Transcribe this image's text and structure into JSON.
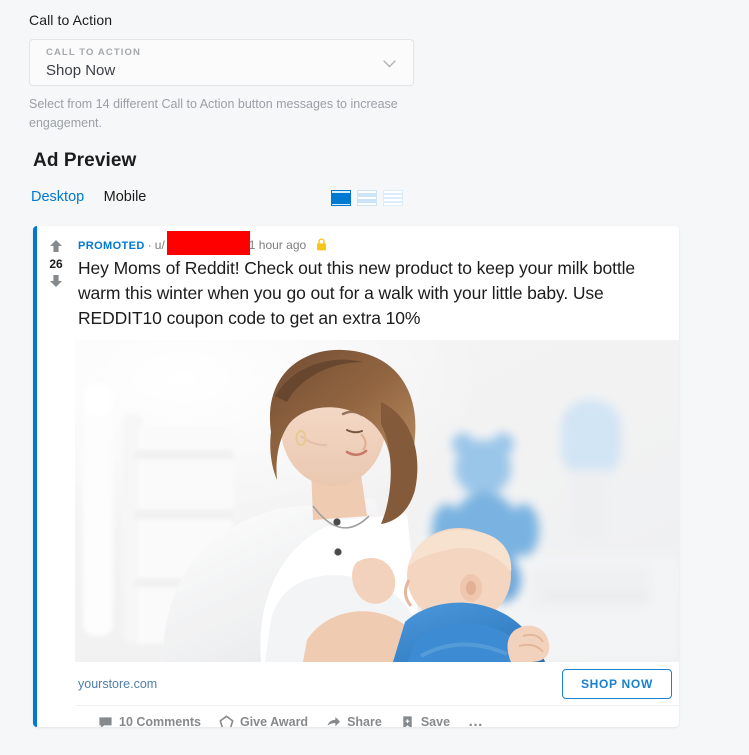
{
  "cta_section": {
    "heading": "Call to Action",
    "select": {
      "overline": "CALL TO ACTION",
      "value": "Shop Now",
      "chevron_icon": "chevron-down-icon"
    },
    "help_text": "Select from 14 different Call to Action button messages to increase engagement."
  },
  "preview": {
    "heading": "Ad Preview",
    "tabs": [
      {
        "label": "Desktop",
        "active": true
      },
      {
        "label": "Mobile",
        "active": false
      }
    ],
    "view_modes": [
      {
        "name": "card-view-icon",
        "selected": true
      },
      {
        "name": "classic-view-icon",
        "selected": false
      },
      {
        "name": "compact-view-icon",
        "selected": false
      }
    ],
    "accent_color": "#0079d3"
  },
  "post": {
    "vote": {
      "upvote_icon": "upvote-arrow-icon",
      "count": "26",
      "downvote_icon": "downvote-arrow-icon"
    },
    "meta": {
      "promoted_label": "PROMOTED",
      "separator": "·",
      "author_prefix": "u/",
      "author_redacted": true,
      "redaction_color": "#fe0000",
      "timestamp": "1 hour ago",
      "lock_icon": "padlock-icon"
    },
    "title": "Hey Moms of Reddit! Check out this new product to keep your milk bottle warm this winter when you go out for a walk with your little baby. Use REDDIT10 coupon code to get an extra 10%",
    "image_alt": "Mother in white top breastfeeding a baby wearing blue, in a bright white nursery with a blue teddy bear",
    "url": "yourstore.com",
    "cta_button_label": "SHOP NOW",
    "actions": [
      {
        "icon": "comment-bubble-icon",
        "label": "10 Comments"
      },
      {
        "icon": "award-icon",
        "label": "Give Award"
      },
      {
        "icon": "share-arrow-icon",
        "label": "Share"
      },
      {
        "icon": "bookmark-icon",
        "label": "Save"
      }
    ],
    "more_actions_icon": "ellipsis-icon",
    "more_actions_label": "…"
  }
}
